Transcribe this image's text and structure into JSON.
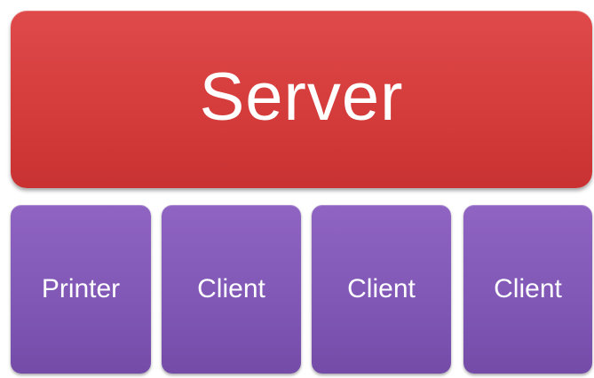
{
  "server": {
    "label": "Server",
    "color": "#d53c3c"
  },
  "devices": [
    {
      "label": "Printer"
    },
    {
      "label": "Client"
    },
    {
      "label": "Client"
    },
    {
      "label": "Client"
    }
  ],
  "device_color": "#8158b6"
}
